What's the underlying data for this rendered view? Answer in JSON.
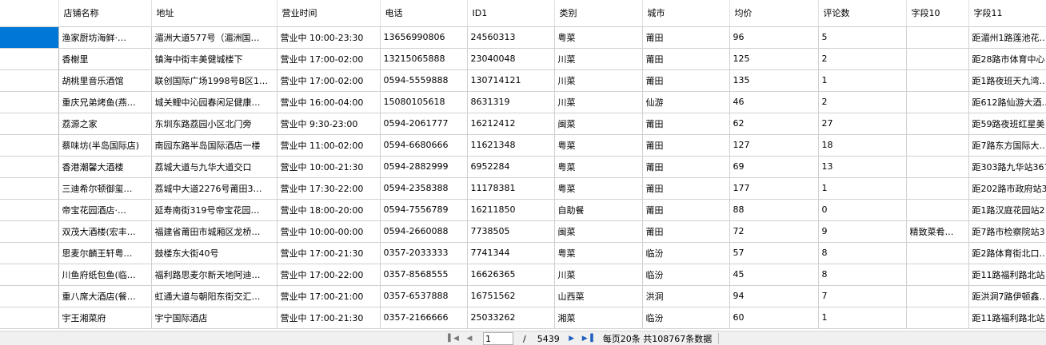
{
  "columns": [
    "",
    "店铺名称",
    "地址",
    "营业时间",
    "电话",
    "ID1",
    "类别",
    "城市",
    "均价",
    "评论数",
    "字段10",
    "字段11"
  ],
  "rows": [
    [
      "",
      "渔家厨坊海鲜·…",
      "湄洲大道577号（湄洲国…",
      "营业中 10:00-23:30",
      "13656990806",
      "24560313",
      "粤菜",
      "莆田",
      "96",
      "5",
      "",
      "距湄州1路莲池花…"
    ],
    [
      "",
      "香榭里",
      "镇海中街丰美健城楼下",
      "营业中 17:00-02:00",
      "13215065888",
      "23040048",
      "川菜",
      "莆田",
      "125",
      "2",
      "",
      "距28路市体育中心"
    ],
    [
      "",
      "胡桃里音乐酒馆",
      "联创国际广场1998号B区1…",
      "营业中 17:00-02:00",
      "0594-5559888",
      "130714121",
      "川菜",
      "莆田",
      "135",
      "1",
      "",
      "距1路夜班天九湾…"
    ],
    [
      "",
      "重庆兄弟烤鱼(燕…",
      "城关鲤中沁园春闲足健康…",
      "营业中 16:00-04:00",
      "15080105618",
      "8631319",
      "川菜",
      "仙游",
      "46",
      "2",
      "",
      "距612路仙游大酒…"
    ],
    [
      "",
      "荔源之家",
      "东圳东路荔园小区北门旁",
      "营业中 9:30-23:00",
      "0594-2061777",
      "16212412",
      "闽菜",
      "莆田",
      "62",
      "27",
      "",
      "距59路夜班红星美"
    ],
    [
      "",
      "蔡味坊(半岛国际店)",
      "南园东路半岛国际酒店一楼",
      "营业中 11:00-02:00",
      "0594-6680666",
      "11621348",
      "粤菜",
      "莆田",
      "127",
      "18",
      "",
      "距7路东方国际大…"
    ],
    [
      "",
      "香港潮馨大酒楼",
      "荔城大道与九华大道交口",
      "营业中 10:00-21:30",
      "0594-2882999",
      "6952284",
      "粤菜",
      "莆田",
      "69",
      "13",
      "",
      "距303路九华站367"
    ],
    [
      "",
      "三迪希尔顿御玺…",
      "荔城中大道2276号莆田3…",
      "营业中 17:30-22:00",
      "0594-2358388",
      "11178381",
      "粤菜",
      "莆田",
      "177",
      "1",
      "",
      "距202路市政府站3"
    ],
    [
      "",
      "帝宝花园酒店·…",
      "延寿南街319号帝宝花园…",
      "营业中 18:00-20:00",
      "0594-7556789",
      "16211850",
      "自助餐",
      "莆田",
      "88",
      "0",
      "",
      "距1路汉庭花园站2"
    ],
    [
      "",
      "双茂大酒楼(宏丰…",
      "福建省莆田市城厢区龙桥…",
      "营业中 10:00-00:00",
      "0594-2660088",
      "7738505",
      "闽菜",
      "莆田",
      "72",
      "9",
      "精致菜肴…",
      "距7路市检察院站3"
    ],
    [
      "",
      "思麦尔麟王轩粤…",
      "鼓楼东大街40号",
      "营业中 17:00-21:30",
      "0357-2033333",
      "7741344",
      "粤菜",
      "临汾",
      "57",
      "8",
      "",
      "距2路体育街北口…"
    ],
    [
      "",
      "川鱼府纸包鱼(临…",
      "福利路思麦尔新天地阿迪…",
      "营业中 17:00-22:00",
      "0357-8568555",
      "16626365",
      "川菜",
      "临汾",
      "45",
      "8",
      "",
      "距11路福利路北站"
    ],
    [
      "",
      "重八席大酒店(餐…",
      "虹通大道与朝阳东街交汇…",
      "营业中 17:00-21:00",
      "0357-6537888",
      "16751562",
      "山西菜",
      "洪洞",
      "94",
      "7",
      "",
      "距洪洞7路伊顿鑫…"
    ],
    [
      "",
      "宇王湘菜府",
      "宇宁国际酒店",
      "营业中 17:00-21:30",
      "0357-2166666",
      "25033262",
      "湘菜",
      "临汾",
      "60",
      "1",
      "",
      "距11路福利路北站"
    ]
  ],
  "pager": {
    "current_page": "1",
    "separator": "/",
    "total_pages": "5439",
    "info": "每页20条 共108767条数据"
  },
  "colors": {
    "selection": "#0078d7",
    "grid_line": "#d0d0d0"
  }
}
